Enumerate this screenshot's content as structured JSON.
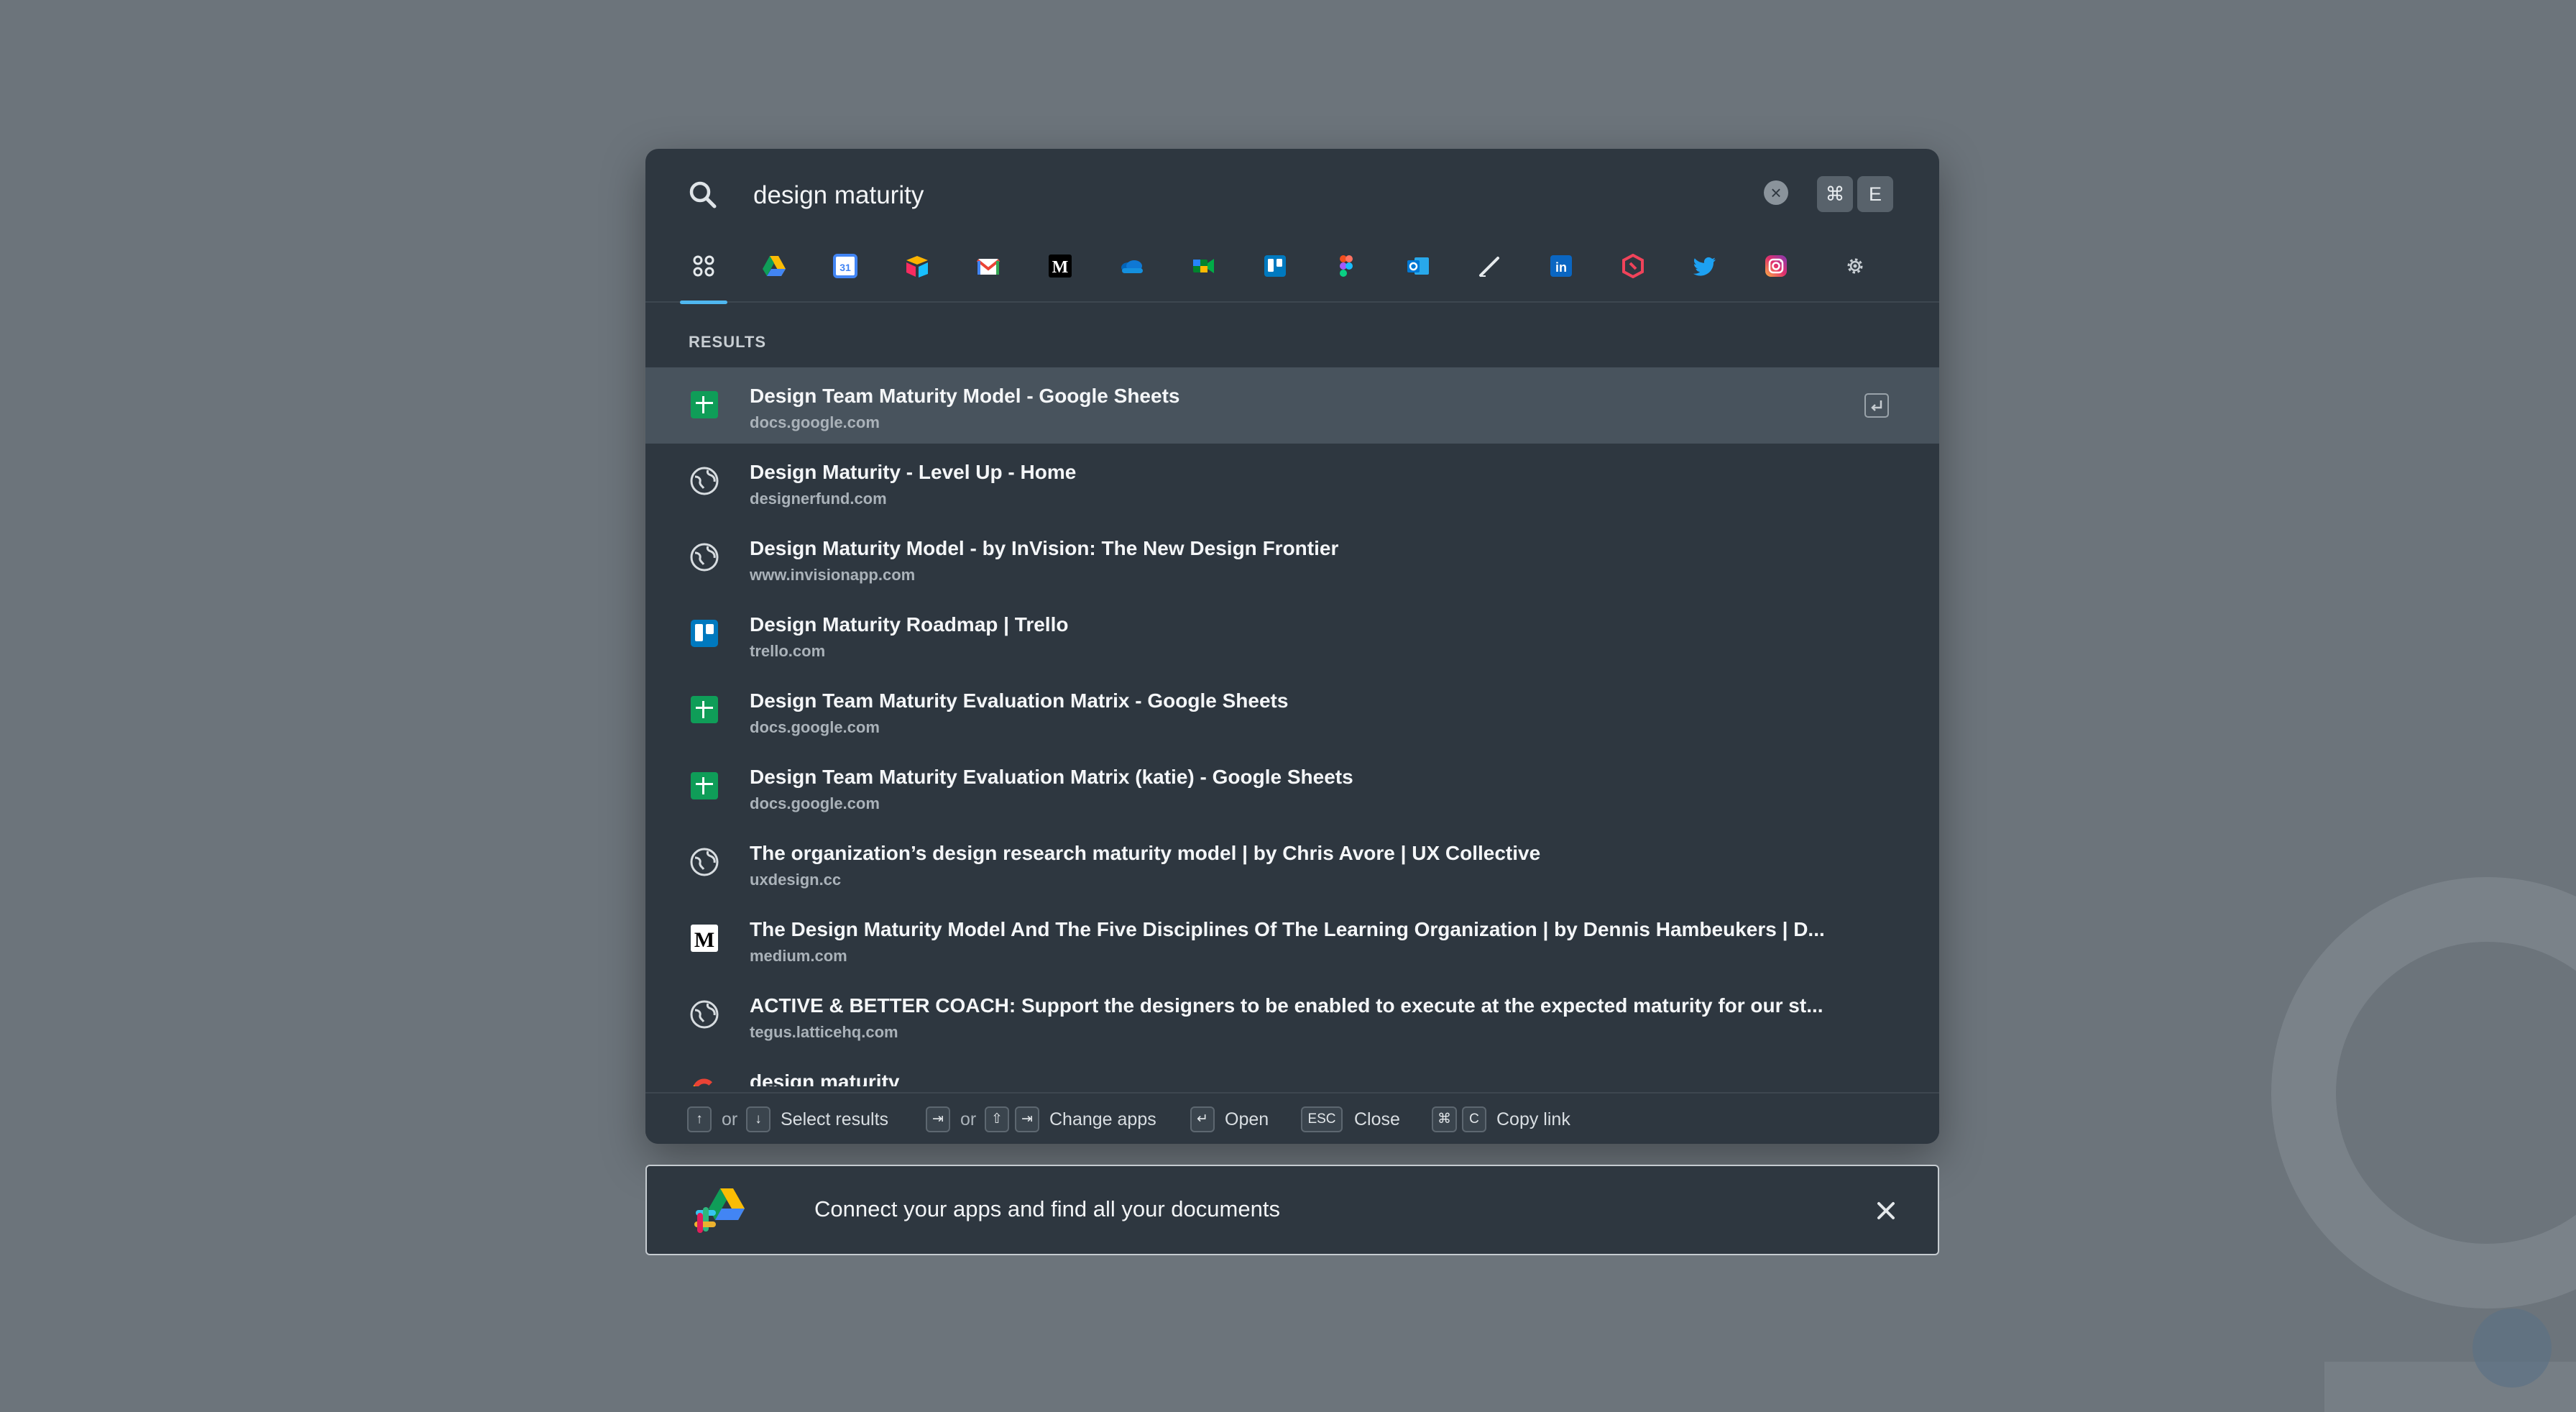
{
  "search": {
    "query": "design maturity",
    "shortcut_keys": [
      "⌘",
      "E"
    ]
  },
  "app_tabs": [
    {
      "name": "all-apps",
      "icon": "grid-icon",
      "active": true
    },
    {
      "name": "google-drive",
      "icon": "google-drive-icon"
    },
    {
      "name": "google-calendar",
      "icon": "google-calendar-icon",
      "label": "31"
    },
    {
      "name": "airtable",
      "icon": "airtable-icon"
    },
    {
      "name": "gmail",
      "icon": "gmail-icon",
      "label": "M"
    },
    {
      "name": "medium",
      "icon": "medium-icon",
      "label": "M"
    },
    {
      "name": "onedrive",
      "icon": "onedrive-icon"
    },
    {
      "name": "google-meet",
      "icon": "google-meet-icon"
    },
    {
      "name": "trello",
      "icon": "trello-icon"
    },
    {
      "name": "figma",
      "icon": "figma-icon"
    },
    {
      "name": "outlook",
      "icon": "outlook-icon",
      "label": "O"
    },
    {
      "name": "pen",
      "icon": "pen-icon"
    },
    {
      "name": "linkedin",
      "icon": "linkedin-icon",
      "label": "in"
    },
    {
      "name": "lattice",
      "icon": "lattice-icon"
    },
    {
      "name": "twitter",
      "icon": "twitter-icon"
    },
    {
      "name": "instagram",
      "icon": "instagram-icon"
    },
    {
      "name": "settings",
      "icon": "gear-icon"
    }
  ],
  "results_label": "RESULTS",
  "results": [
    {
      "title": "Design Team Maturity Model - Google Sheets",
      "sub": "docs.google.com",
      "icon": "google-sheets-icon",
      "selected": true
    },
    {
      "title": "Design Maturity - Level Up - Home",
      "sub": "designerfund.com",
      "icon": "globe-icon"
    },
    {
      "title": "Design Maturity Model - by InVision: The New Design Frontier",
      "sub": "www.invisionapp.com",
      "icon": "globe-icon"
    },
    {
      "title": "Design Maturity Roadmap | Trello",
      "sub": "trello.com",
      "icon": "trello-icon"
    },
    {
      "title": "Design Team Maturity Evaluation Matrix - Google Sheets",
      "sub": "docs.google.com",
      "icon": "google-sheets-icon"
    },
    {
      "title": "Design Team Maturity Evaluation Matrix (katie) - Google Sheets",
      "sub": "docs.google.com",
      "icon": "google-sheets-icon"
    },
    {
      "title": "The organization’s design research maturity model | by Chris Avore | UX Collective",
      "sub": "uxdesign.cc",
      "icon": "globe-icon"
    },
    {
      "title": "The Design Maturity Model And The Five Disciplines Of The Learning Organization | by Dennis Hambeukers | D...",
      "sub": "medium.com",
      "icon": "medium-icon"
    },
    {
      "title": "ACTIVE & BETTER COACH: Support the designers to be enabled to execute at the expected maturity for our st...",
      "sub": "tegus.latticehq.com",
      "icon": "globe-icon"
    },
    {
      "title": "design maturity",
      "sub": "",
      "icon": "google-icon"
    }
  ],
  "footer": {
    "or_text": "or",
    "select_results": "Select results",
    "change_apps": "Change apps",
    "open": "Open",
    "esc_key": "ESC",
    "close": "Close",
    "cmd_key": "⌘",
    "c_key": "C",
    "copy_link": "Copy link"
  },
  "banner": {
    "text": "Connect your apps and find all your documents"
  },
  "colors": {
    "panel": "#2e3740",
    "selected_row": "#48535d",
    "accent": "#4fb7f0",
    "backdrop": "#6c747b"
  }
}
